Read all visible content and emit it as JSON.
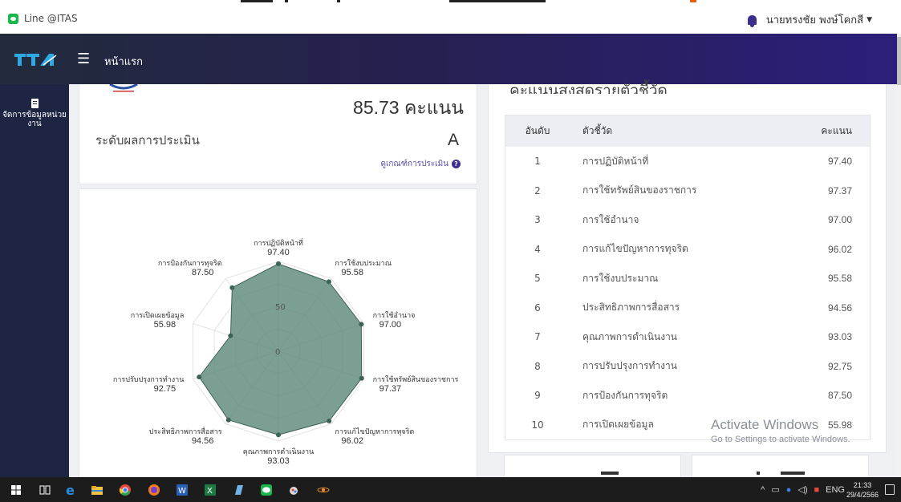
{
  "topbar": {
    "line_link": "Line @ITAS",
    "user_name": "นายทรงชัย พงษ์โคกสี"
  },
  "header": {
    "logo_text": "ITA",
    "menu_icon": "hamburger-icon",
    "home_label": "หน้าแรก",
    "gradient": [
      "#222b3d",
      "#2b1f7a"
    ]
  },
  "sidebar": {
    "items": [
      {
        "label": "จัดการข้อมูลหน่วยงาน",
        "icon": "clipboard-icon"
      }
    ]
  },
  "score_card": {
    "total_score": "85.73 คะแนน",
    "level_label": "ระดับผลการประเมิน",
    "level_grade": "A",
    "criteria_link": "ดูเกณฑ์การประเมิน"
  },
  "chart_data": {
    "type": "radar",
    "scale_labels": [
      "0",
      "50"
    ],
    "range": [
      0,
      100
    ],
    "fill_color": "#5e8a7a",
    "point_color": "#3e6257",
    "axes": [
      {
        "label": "การปฏิบัติหน้าที่",
        "value": 97.4,
        "value_label": "97.40"
      },
      {
        "label": "การใช้งบประมาณ",
        "value": 95.58,
        "value_label": "95.58"
      },
      {
        "label": "การใช้อำนาจ",
        "value": 97.0,
        "value_label": "97.00"
      },
      {
        "label": "การใช้ทรัพย์สินของราชการ",
        "value": 97.37,
        "value_label": "97.37"
      },
      {
        "label": "การแก้ไขปัญหาการทุจริต",
        "value": 96.02,
        "value_label": "96.02"
      },
      {
        "label": "คุณภาพการดำเนินงาน",
        "value": 93.03,
        "value_label": "93.03"
      },
      {
        "label": "ประสิทธิภาพการสื่อสาร",
        "value": 94.56,
        "value_label": "94.56"
      },
      {
        "label": "การปรับปรุงการทำงาน",
        "value": 92.75,
        "value_label": "92.75"
      },
      {
        "label": "การเปิดเผยข้อมูล",
        "value": 55.98,
        "value_label": "55.98"
      },
      {
        "label": "การป้องกันการทุจริต",
        "value": 87.5,
        "value_label": "87.50"
      }
    ]
  },
  "ranking": {
    "title": "คะแนนสูงสุดรายตัวชี้วัด",
    "headers": {
      "rank": "อันดับ",
      "name": "ตัวชี้วัด",
      "score": "คะแนน"
    },
    "rows": [
      {
        "rank": "1",
        "name": "การปฏิบัติหน้าที่",
        "score": "97.40"
      },
      {
        "rank": "2",
        "name": "การใช้ทรัพย์สินของราชการ",
        "score": "97.37"
      },
      {
        "rank": "3",
        "name": "การใช้อำนาจ",
        "score": "97.00"
      },
      {
        "rank": "4",
        "name": "การแก้ไขปัญหาการทุจริต",
        "score": "96.02"
      },
      {
        "rank": "5",
        "name": "การใช้งบประมาณ",
        "score": "95.58"
      },
      {
        "rank": "6",
        "name": "ประสิทธิภาพการสื่อสาร",
        "score": "94.56"
      },
      {
        "rank": "7",
        "name": "คุณภาพการดำเนินงาน",
        "score": "93.03"
      },
      {
        "rank": "8",
        "name": "การปรับปรุงการทำงาน",
        "score": "92.75"
      },
      {
        "rank": "9",
        "name": "การป้องกันการทุจริต",
        "score": "87.50"
      },
      {
        "rank": "10",
        "name": "การเปิดเผยข้อมูล",
        "score": "55.98"
      }
    ]
  },
  "watermark": {
    "title": "Activate Windows",
    "subtitle": "Go to Settings to activate Windows."
  },
  "taskbar": {
    "language": "ENG",
    "time": "21:33",
    "date": "29/4/2566",
    "icons": [
      "windows-start-icon",
      "task-view-icon",
      "edge-icon",
      "file-explorer-icon",
      "chrome-icon",
      "firefox-icon",
      "word-icon",
      "excel-icon",
      "notepad-icon",
      "line-app-icon",
      "paint-icon",
      "react-icon"
    ]
  }
}
